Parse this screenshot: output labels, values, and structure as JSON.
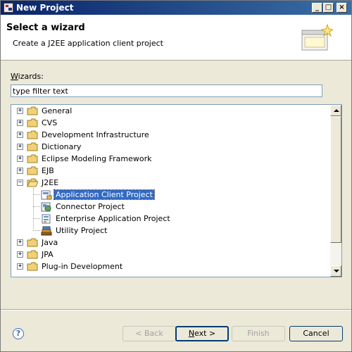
{
  "window": {
    "title": "New Project",
    "controls": [
      "_",
      "□",
      "×"
    ]
  },
  "header": {
    "title": "Select a wizard",
    "description": "Create a J2EE application client project"
  },
  "filter": {
    "label_prefix": "W",
    "label_rest": "izards:",
    "value": "type filter text"
  },
  "tree": {
    "items": [
      {
        "label": "General",
        "expanded": false
      },
      {
        "label": "CVS",
        "expanded": false
      },
      {
        "label": "Development Infrastructure",
        "expanded": false
      },
      {
        "label": "Dictionary",
        "expanded": false
      },
      {
        "label": "Eclipse Modeling Framework",
        "expanded": false
      },
      {
        "label": "EJB",
        "expanded": false
      },
      {
        "label": "J2EE",
        "expanded": true,
        "children": [
          {
            "label": "Application Client Project",
            "selected": true
          },
          {
            "label": "Connector Project"
          },
          {
            "label": "Enterprise Application Project"
          },
          {
            "label": "Utility Project"
          }
        ]
      },
      {
        "label": "Java",
        "expanded": false
      },
      {
        "label": "JPA",
        "expanded": false
      },
      {
        "label": "Plug-in Development",
        "expanded": false
      }
    ]
  },
  "footer": {
    "help": "?",
    "back": "< Back",
    "next_u": "N",
    "next_rest": "ext >",
    "finish": "Finish",
    "cancel": "Cancel"
  }
}
